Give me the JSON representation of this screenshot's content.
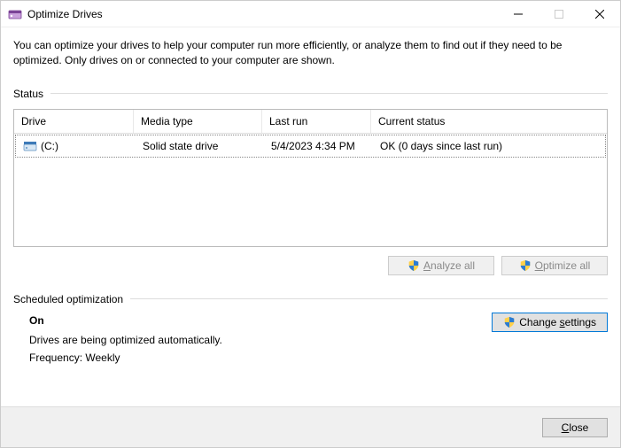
{
  "window": {
    "title": "Optimize Drives"
  },
  "intro": "You can optimize your drives to help your computer run more efficiently, or analyze them to find out if they need to be optimized. Only drives on or connected to your computer are shown.",
  "status_section": {
    "label": "Status",
    "columns": {
      "drive": "Drive",
      "media": "Media type",
      "last": "Last run",
      "status": "Current status"
    },
    "rows": [
      {
        "drive": "(C:)",
        "media": "Solid state drive",
        "last": "5/4/2023 4:34 PM",
        "status": "OK (0 days since last run)"
      }
    ]
  },
  "buttons": {
    "analyze": "Analyze all",
    "optimize": "Optimize all",
    "change": "Change settings",
    "close": "Close"
  },
  "schedule_section": {
    "label": "Scheduled optimization",
    "status": "On",
    "desc": "Drives are being optimized automatically.",
    "freq": "Frequency: Weekly"
  }
}
